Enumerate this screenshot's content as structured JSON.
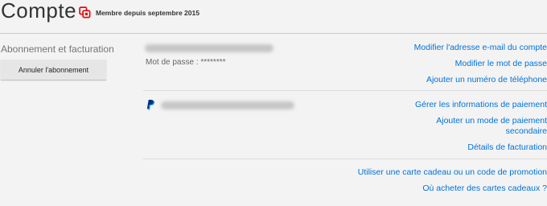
{
  "header": {
    "title": "Compte",
    "member_since": "Membre depuis septembre 2015"
  },
  "membership": {
    "section_title": "Abonnement et facturation",
    "cancel_button": "Annuler l'abonnement",
    "email_value": "",
    "password_label": "Mot de passe : ********",
    "links": {
      "change_email": "Modifier l'adresse e-mail du compte",
      "change_password": "Modifier le mot de passe",
      "add_phone": "Ajouter un numéro de téléphone"
    }
  },
  "payment": {
    "method_icon": "paypal-icon",
    "paypal_account": "",
    "links": {
      "manage_payment": "Gérer les informations de paiement",
      "add_secondary_line1": "Ajouter un mode de paiement",
      "add_secondary_line2": "secondaire",
      "billing_details": "Détails de facturation"
    }
  },
  "gift": {
    "links": {
      "redeem": "Utiliser une carte cadeau ou un code de promotion",
      "where_to_buy": "Où acheter des cartes cadeaux ?"
    }
  },
  "colors": {
    "background": "#f3f3f3",
    "link": "#0072d8",
    "brand_red": "#e50914",
    "button": "#e6e6e6"
  }
}
